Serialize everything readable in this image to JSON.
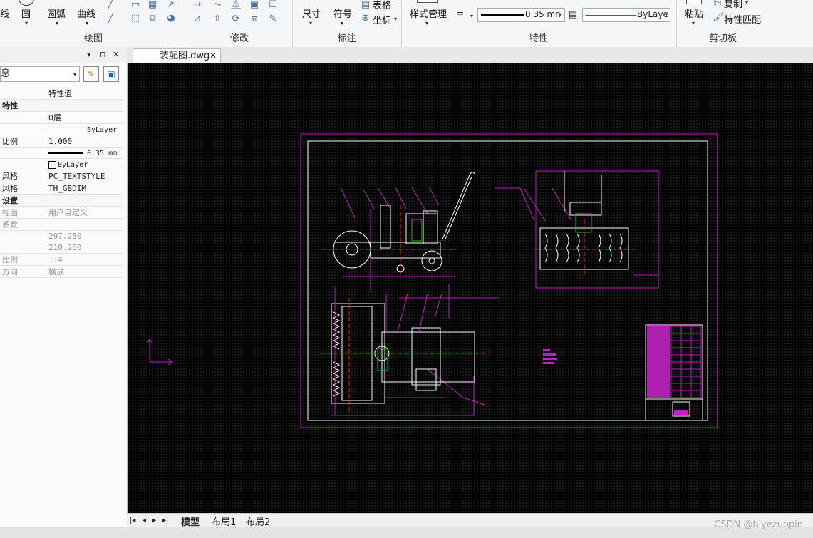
{
  "ribbon": {
    "draw": {
      "group_label": "绘图",
      "line": "线",
      "circle": "圆",
      "arc": "圆弧",
      "curve": "曲线"
    },
    "modify": {
      "group_label": "修改"
    },
    "annotate": {
      "group_label": "标注",
      "dimension": "尺寸",
      "symbol": "符号",
      "table": "表格",
      "coordinate": "坐标"
    },
    "properties": {
      "group_label": "特性",
      "style_manager": "样式管理",
      "lineweight": "0.35 mn",
      "linetype": "ByLaye"
    },
    "clipboard": {
      "group_label": "剪切板",
      "paste": "粘贴",
      "copy": "复制",
      "match": "特性匹配"
    }
  },
  "panel": {
    "combo_value": "息",
    "col_value_header": "特性值",
    "rows": [
      {
        "k": "特性",
        "v": "",
        "type": "section"
      },
      {
        "k": "",
        "v": "0层",
        "type": "normal"
      },
      {
        "k": "",
        "v": "ByLayer",
        "type": "line"
      },
      {
        "k": "比例",
        "v": "1.000",
        "type": "mono"
      },
      {
        "k": "",
        "v": "0.35 mm",
        "type": "thickline"
      },
      {
        "k": "",
        "v": "ByLayer",
        "type": "color"
      },
      {
        "k": "风格",
        "v": "PC_TEXTSTYLE",
        "type": "mono"
      },
      {
        "k": "风格",
        "v": "TH_GBDIM",
        "type": "mono"
      },
      {
        "k": "设置",
        "v": "",
        "type": "section"
      },
      {
        "k": "幅面",
        "v": "用户自定义",
        "type": "gray"
      },
      {
        "k": "系数",
        "v": "",
        "type": "gray"
      },
      {
        "k": "",
        "v": "297.250",
        "type": "graymono"
      },
      {
        "k": "",
        "v": "210.250",
        "type": "graymono"
      },
      {
        "k": "比例",
        "v": "1:4",
        "type": "graymono"
      },
      {
        "k": "方向",
        "v": "横放",
        "type": "gray"
      }
    ]
  },
  "document": {
    "tab_title": "装配图.dwg"
  },
  "layout_tabs": {
    "model": "模型",
    "layout1": "布局1",
    "layout2": "布局2"
  },
  "watermark": "CSDN @biyezuopin",
  "colors": {
    "magenta": "#c020c0",
    "canvas_bg": "#000000",
    "white": "#ffffff",
    "red": "#ff2020",
    "green": "#20c020"
  }
}
